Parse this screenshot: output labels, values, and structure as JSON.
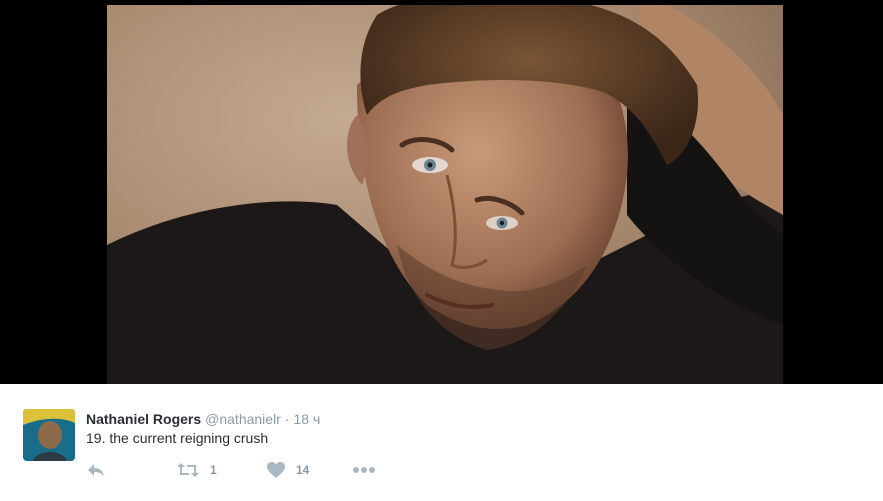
{
  "tweet": {
    "fullname": "Nathaniel Rogers",
    "username": "@nathanielr",
    "separator": "·",
    "time": "18 ч",
    "text": "19. the current reigning crush",
    "actions": {
      "retweet_count": "1",
      "like_count": "14"
    }
  },
  "icons": {
    "reply": "reply-icon",
    "retweet": "retweet-icon",
    "like": "heart-icon",
    "more": "more-dots-icon"
  },
  "colors": {
    "name": "#292f33",
    "muted": "#8899a6",
    "icon": "#aab8c2"
  }
}
